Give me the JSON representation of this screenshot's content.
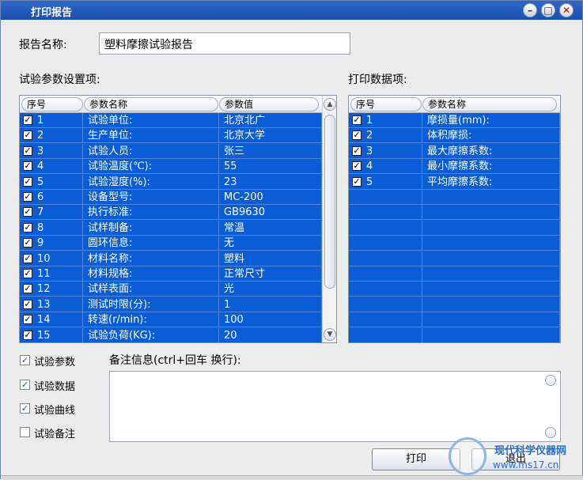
{
  "window": {
    "title": "打印报告",
    "accent": "#0a5dd6",
    "title_bar_color": "#1f56b8"
  },
  "report_name": {
    "label": "报告名称:",
    "value": "塑料摩擦试验报告"
  },
  "params_section": {
    "label": "试验参数设置项:",
    "columns": [
      "序号",
      "参数名称",
      "参数值"
    ],
    "rows": [
      {
        "no": "1",
        "name": "试验单位:",
        "value": "北京北广"
      },
      {
        "no": "2",
        "name": "生产单位:",
        "value": "北京大学"
      },
      {
        "no": "3",
        "name": "试验人员:",
        "value": "张三"
      },
      {
        "no": "4",
        "name": "试验温度(℃):",
        "value": "55"
      },
      {
        "no": "5",
        "name": "试验湿度(%):",
        "value": "23"
      },
      {
        "no": "6",
        "name": "设备型号:",
        "value": "MC-200"
      },
      {
        "no": "7",
        "name": "执行标准:",
        "value": "GB9630"
      },
      {
        "no": "8",
        "name": "试样制备:",
        "value": "常温"
      },
      {
        "no": "9",
        "name": "圆环信息:",
        "value": "无"
      },
      {
        "no": "10",
        "name": "材料名称:",
        "value": "塑料"
      },
      {
        "no": "11",
        "name": "材料规格:",
        "value": "正常尺寸"
      },
      {
        "no": "12",
        "name": "试样表面:",
        "value": "光"
      },
      {
        "no": "13",
        "name": "测试时限(分):",
        "value": "1"
      },
      {
        "no": "14",
        "name": "转速(r/min):",
        "value": "100"
      },
      {
        "no": "15",
        "name": "试验负荷(KG):",
        "value": "20"
      }
    ]
  },
  "print_section": {
    "label": "打印数据项:",
    "columns": [
      "序号",
      "参数名称"
    ],
    "rows": [
      {
        "no": "1",
        "name": "摩损量(mm):"
      },
      {
        "no": "2",
        "name": "体积摩损:"
      },
      {
        "no": "3",
        "name": "最大摩擦系数:"
      },
      {
        "no": "4",
        "name": "最小摩擦系数:"
      },
      {
        "no": "5",
        "name": "平均摩擦系数:"
      }
    ]
  },
  "options": [
    {
      "label": "试验参数",
      "checked": true
    },
    {
      "label": "试验数据",
      "checked": true
    },
    {
      "label": "试验曲线",
      "checked": true
    },
    {
      "label": "试验备注",
      "checked": false
    }
  ],
  "notes": {
    "label": "备注信息(ctrl+回车 换行):",
    "value": ""
  },
  "buttons": {
    "print": "打印",
    "exit": "退出"
  },
  "watermark": {
    "text": "现代科学仪器网",
    "url": "www.ms17.cn"
  }
}
